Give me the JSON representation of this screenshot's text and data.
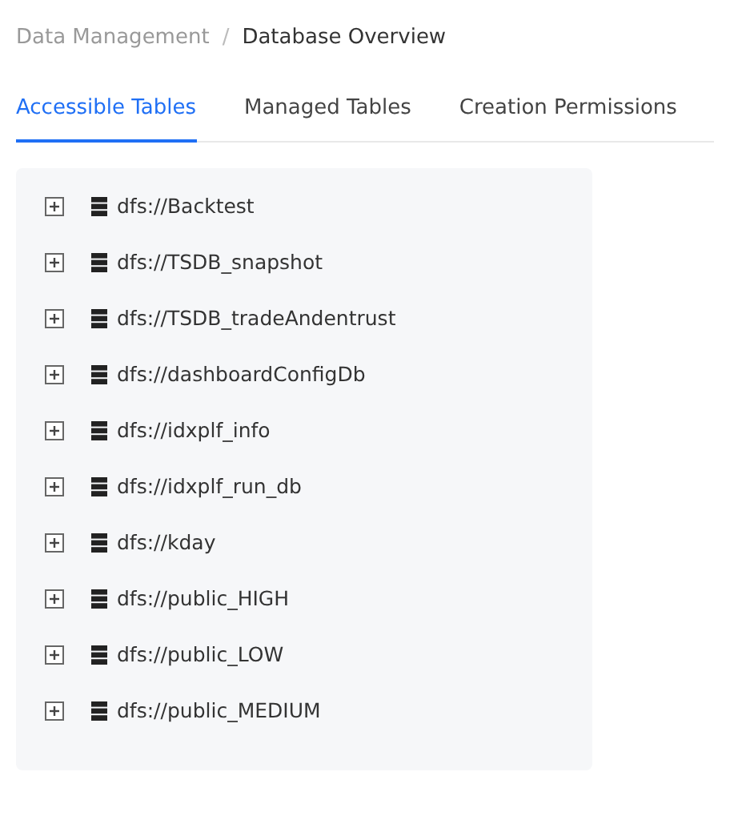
{
  "breadcrumb": [
    {
      "label": "Data Management",
      "current": false
    },
    {
      "label": "/",
      "current": false
    },
    {
      "label": "Database Overview",
      "current": true
    }
  ],
  "tabs": [
    {
      "label": "Accessible Tables",
      "selected": true
    },
    {
      "label": "Managed Tables",
      "selected": false
    },
    {
      "label": "Creation Permissions",
      "selected": false
    }
  ],
  "tree": [
    {
      "name": "dfs://Backtest",
      "expanded": false
    },
    {
      "name": "dfs://TSDB_snapshot",
      "expanded": false
    },
    {
      "name": "dfs://TSDB_tradeAndentrust",
      "expanded": false
    },
    {
      "name": "dfs://dashboardConfigDb",
      "expanded": false
    },
    {
      "name": "dfs://idxplf_info",
      "expanded": false
    },
    {
      "name": "dfs://idxplf_run_db",
      "expanded": false
    },
    {
      "name": "dfs://kday",
      "expanded": false
    },
    {
      "name": "dfs://public_HIGH",
      "expanded": false
    },
    {
      "name": "dfs://public_LOW",
      "expanded": false
    },
    {
      "name": "dfs://public_MEDIUM",
      "expanded": false
    }
  ]
}
